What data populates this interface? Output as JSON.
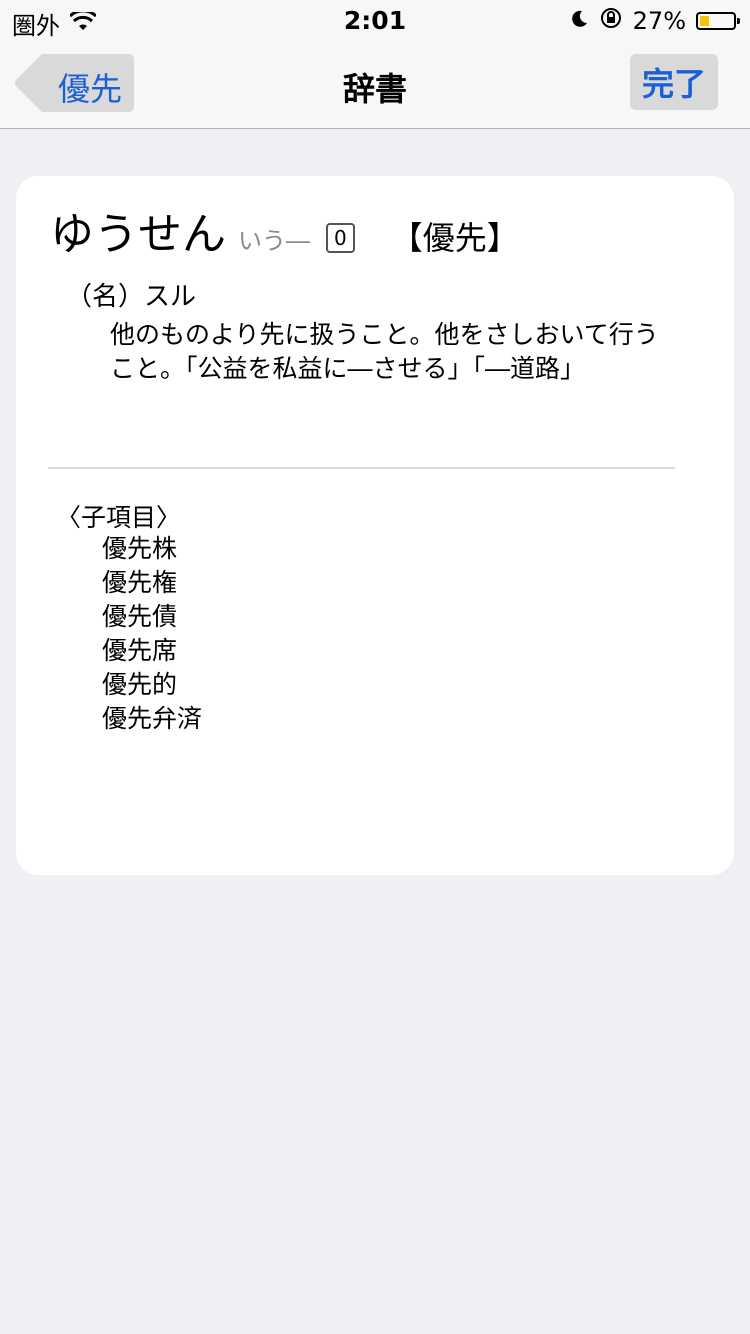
{
  "status_bar": {
    "carrier": "圏外",
    "time": "2:01",
    "battery_percent": "27%",
    "battery_level": 0.27,
    "icons": [
      "wifi-icon",
      "moon-icon",
      "orientation-lock-icon",
      "battery-icon"
    ]
  },
  "nav": {
    "back_label": "優先",
    "title": "辞書",
    "done_label": "完了"
  },
  "entry": {
    "headword": "ゆうせん",
    "reading_note": "いう―",
    "accent": "0",
    "kanji": "【優先】",
    "part_of_speech": "（名）スル",
    "definition": "他のものより先に扱うこと。他をさしおいて行うこと。「公益を私益に―させる」「―道路」",
    "sub_heading": "〈子項目〉",
    "sub_items": [
      "優先株",
      "優先権",
      "優先債",
      "優先席",
      "優先的",
      "優先弁済"
    ]
  },
  "colors": {
    "accent": "#1c5fd4",
    "background": "#efeff4",
    "battery": "#f6c400"
  }
}
